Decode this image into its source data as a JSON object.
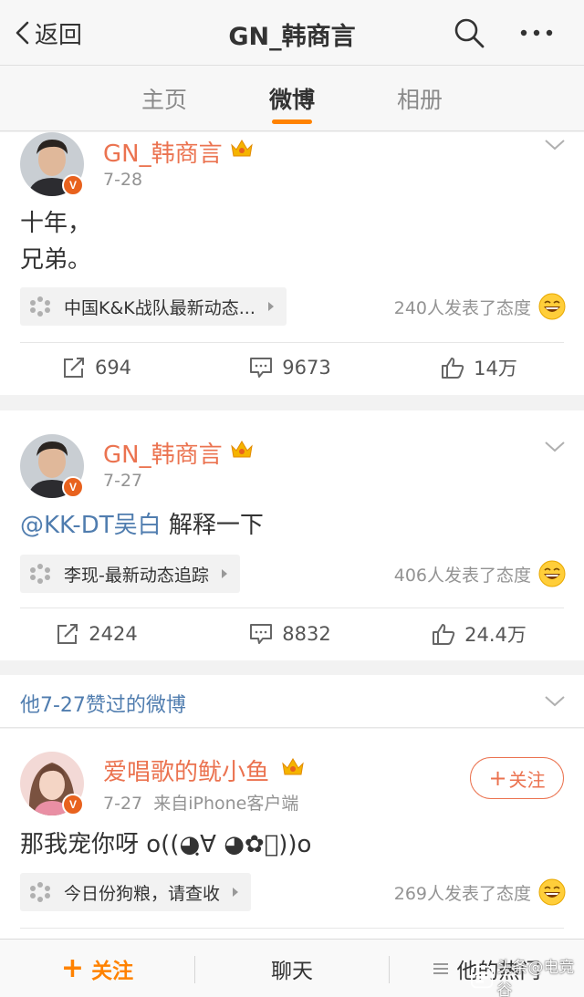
{
  "nav": {
    "back_label": "返回",
    "title": "GN_韩商言"
  },
  "tabs": [
    {
      "label": "主页",
      "active": false
    },
    {
      "label": "微博",
      "active": true
    },
    {
      "label": "相册",
      "active": false
    }
  ],
  "posts": [
    {
      "username": "GN_韩商言",
      "verified_badge": "V",
      "date": "7-28",
      "text_lines": [
        "十年，",
        "兄弟。"
      ],
      "topic": "中国K&K战队最新动态...",
      "reactions": "240人发表了态度",
      "actions": {
        "repost": "694",
        "comment": "9673",
        "like": "14万"
      }
    },
    {
      "username": "GN_韩商言",
      "verified_badge": "V",
      "date": "7-27",
      "mention": "@KK-DT吴白",
      "text": " 解释一下",
      "topic": "李现-最新动态追踪",
      "reactions": "406人发表了态度",
      "actions": {
        "repost": "2424",
        "comment": "8832",
        "like": "24.4万"
      }
    }
  ],
  "liked_section": {
    "title": "他7-27赞过的微博"
  },
  "liked_post": {
    "username": "爱唱歌的鱿小鱼",
    "verified_badge": "V",
    "date": "7-27",
    "source": "来自iPhone客户端",
    "follow_plus": "+",
    "follow_label": "关注",
    "text": "那我宠你呀 o((◕ฺ∀ ◕✿ฺ))o",
    "topic": "今日份狗粮，请查收",
    "reactions": "269人发表了态度"
  },
  "bottom_bar": {
    "follow_plus": "+",
    "follow_label": "关注",
    "chat_label": "聊天",
    "hot_label": "他的热门"
  },
  "watermark": "头条@电竞谷",
  "colors": {
    "accent": "#ff8200",
    "username": "#eb7350",
    "link": "#507daf",
    "meta": "#939393"
  }
}
